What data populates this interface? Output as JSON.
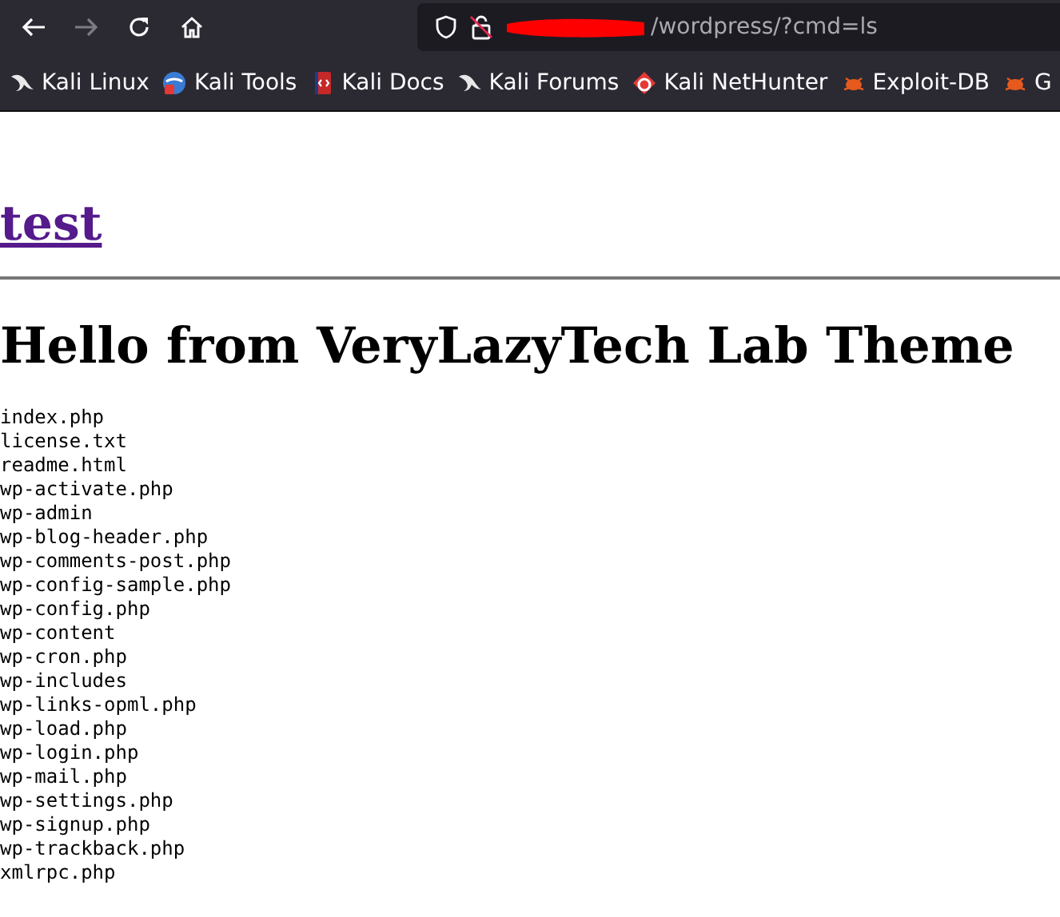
{
  "toolbar": {
    "nav": [
      {
        "kind": "back",
        "disabled": false
      },
      {
        "kind": "forward",
        "disabled": true
      },
      {
        "kind": "reload",
        "disabled": false
      },
      {
        "kind": "home",
        "disabled": false
      }
    ],
    "address": {
      "url": "/wordpress/?cmd=ls",
      "redacted": true
    }
  },
  "bookmarks": [
    {
      "label": "Kali Linux",
      "kind": "dragon"
    },
    {
      "label": "Kali Tools",
      "kind": "tools"
    },
    {
      "label": "Kali Docs",
      "kind": "docs"
    },
    {
      "label": "Kali Forums",
      "kind": "dragon"
    },
    {
      "label": "Kali NetHunter",
      "kind": "nethunter"
    },
    {
      "label": "Exploit-DB",
      "kind": "bug"
    },
    {
      "label": "G",
      "kind": "bug"
    }
  ],
  "page": {
    "site_title": "test",
    "heading": "Hello from VeryLazyTech Lab Theme",
    "listing": [
      "index.php",
      "license.txt",
      "readme.html",
      "wp-activate.php",
      "wp-admin",
      "wp-blog-header.php",
      "wp-comments-post.php",
      "wp-config-sample.php",
      "wp-config.php",
      "wp-content",
      "wp-cron.php",
      "wp-includes",
      "wp-links-opml.php",
      "wp-load.php",
      "wp-login.php",
      "wp-mail.php",
      "wp-settings.php",
      "wp-signup.php",
      "wp-trackback.php",
      "xmlrpc.php"
    ]
  }
}
